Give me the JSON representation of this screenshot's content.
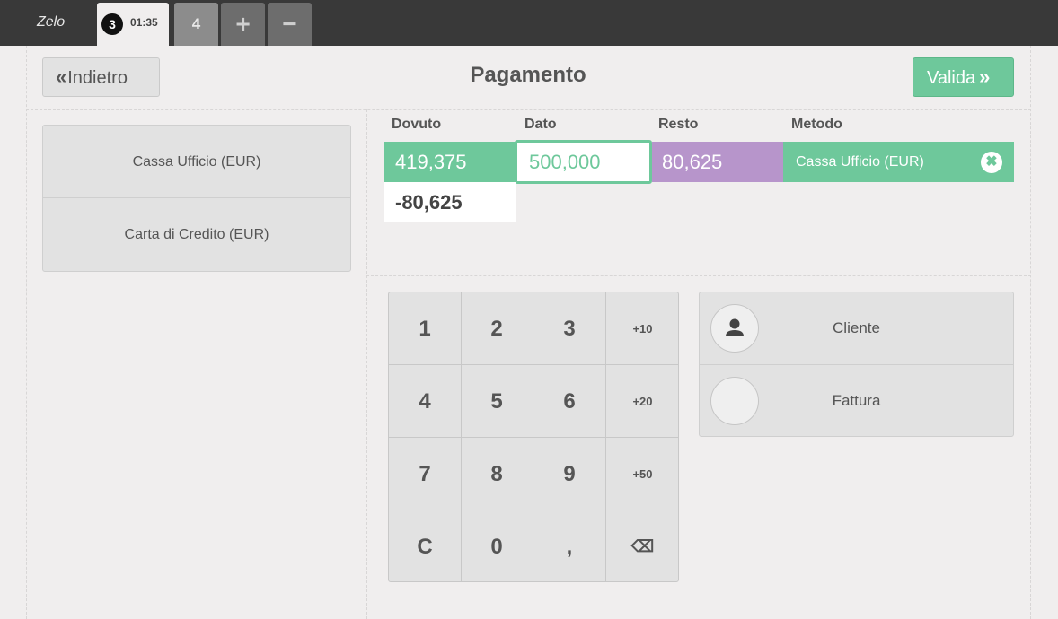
{
  "topbar": {
    "brand": "Zelo",
    "active_order": {
      "number": "3",
      "time": "01:35"
    },
    "tabs": [
      {
        "label": "4"
      },
      {
        "label": "+"
      },
      {
        "label": "−"
      }
    ]
  },
  "header": {
    "back_label": "Indietro",
    "back_icon": "«",
    "title": "Pagamento",
    "validate_label": "Valida",
    "validate_icon": "»"
  },
  "payment_methods": [
    {
      "label": "Cassa Ufficio (EUR)"
    },
    {
      "label": "Carta di Credito (EUR)"
    }
  ],
  "payment_table": {
    "headers": {
      "due": "Dovuto",
      "given": "Dato",
      "change": "Resto",
      "method": "Metodo"
    },
    "line": {
      "due": "419,375",
      "given": "500,000",
      "change": "80,625",
      "method": "Cassa Ufficio (EUR)"
    },
    "remaining": "-80,625",
    "remove_icon": "✖"
  },
  "numpad": {
    "keys": [
      "1",
      "2",
      "3",
      "+10",
      "4",
      "5",
      "6",
      "+20",
      "7",
      "8",
      "9",
      "+50",
      "C",
      "0",
      ",",
      "⌫"
    ]
  },
  "side_buttons": {
    "client_label": "Cliente",
    "invoice_label": "Fattura"
  },
  "colors": {
    "accent_green": "#6ec89b",
    "change_purple": "#b795cb",
    "topbar": "#393939"
  }
}
